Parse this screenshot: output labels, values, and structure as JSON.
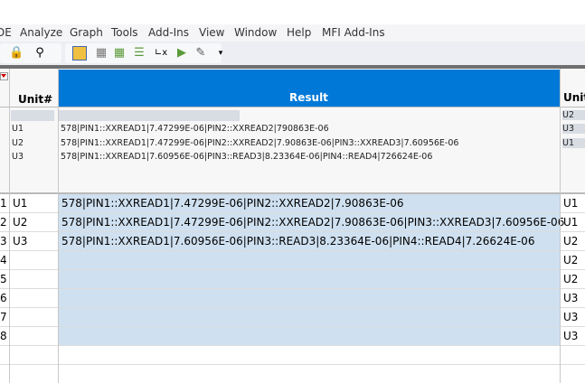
{
  "menu": [
    "DE",
    "Analyze",
    "Graph",
    "Tools",
    "Add-Ins",
    "View",
    "Window",
    "Help",
    "MFI Add-Ins"
  ],
  "columns": {
    "unit_num": "Unit#",
    "result": "Result",
    "unit": "Unit"
  },
  "summary": {
    "units": [
      "U1",
      "U2",
      "U3"
    ],
    "results": [
      "578|PIN1::XXREAD1|7.47299E-06|PIN2::XXREAD2|790863E-06",
      "578|PIN1::XXREAD1|7.47299E-06|PIN2::XXREAD2|7.90863E-06|PIN3::XXREAD3|7.60956E-06",
      "578|PIN1::XXREAD1|7.60956E-06|PIN3::READ3|8.23364E-06|PIN4::READ4|726624E-06"
    ],
    "right_units": [
      "U2",
      "U3",
      "U1"
    ]
  },
  "rows": [
    {
      "n": "1",
      "unit_num": "U1",
      "result": "578|PIN1::XXREAD1|7.47299E-06|PIN2::XXREAD2|7.90863E-06",
      "unit": "U1"
    },
    {
      "n": "2",
      "unit_num": "U2",
      "result": "578|PIN1::XXREAD1|7.47299E-06|PIN2::XXREAD2|7.90863E-06|PIN3::XXREAD3|7.60956E-06",
      "unit": "U1"
    },
    {
      "n": "3",
      "unit_num": "U3",
      "result": "578|PIN1::XXREAD1|7.60956E-06|PIN3::READ3|8.23364E-06|PIN4::READ4|7.26624E-06",
      "unit": "U2"
    },
    {
      "n": "4",
      "unit_num": "",
      "result": "",
      "unit": "U2"
    },
    {
      "n": "5",
      "unit_num": "",
      "result": "",
      "unit": "U2"
    },
    {
      "n": "6",
      "unit_num": "",
      "result": "",
      "unit": "U3"
    },
    {
      "n": "7",
      "unit_num": "",
      "result": "",
      "unit": "U3"
    },
    {
      "n": "8",
      "unit_num": "",
      "result": "",
      "unit": "U3"
    }
  ]
}
